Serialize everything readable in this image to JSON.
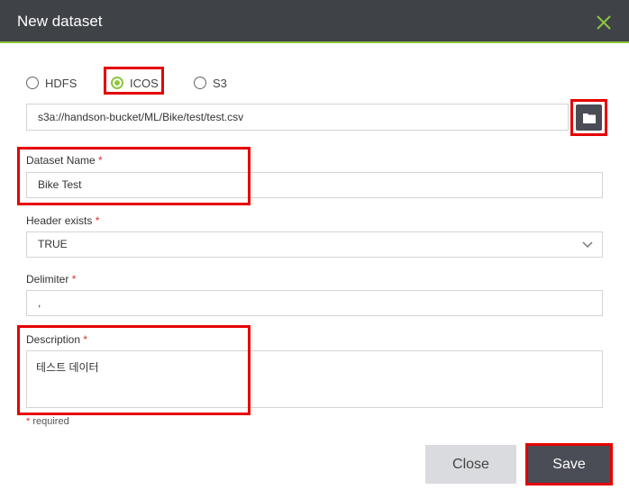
{
  "dialog": {
    "title": "New dataset",
    "close_icon": "close-x-icon",
    "accent_color": "#8cc63f",
    "highlight_color": "#e60000"
  },
  "storage": {
    "options": [
      {
        "label": "HDFS",
        "checked": false
      },
      {
        "label": "ICOS",
        "checked": true
      },
      {
        "label": "S3",
        "checked": false
      }
    ],
    "path_value": "s3a://handson-bucket/ML/Bike/test/test.csv",
    "browse_icon": "folder-icon"
  },
  "form": {
    "dataset_name": {
      "label": "Dataset Name",
      "required_mark": "*",
      "value": "Bike Test"
    },
    "header_exists": {
      "label": "Header exists",
      "required_mark": "*",
      "value": "TRUE"
    },
    "delimiter": {
      "label": "Delimiter",
      "required_mark": "*",
      "value": ","
    },
    "description": {
      "label": "Description",
      "required_mark": "*",
      "value": "테스트 데이터"
    },
    "required_note": {
      "star": "*",
      "text": " required"
    }
  },
  "buttons": {
    "close_label": "Close",
    "save_label": "Save"
  }
}
